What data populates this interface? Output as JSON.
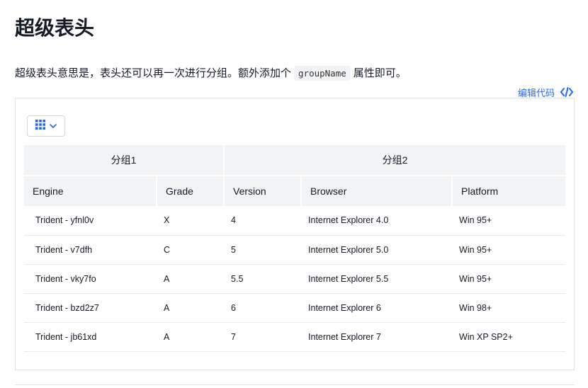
{
  "page": {
    "title": "超级表头",
    "description_before": "超级表头意思是，表头还可以再一次进行分组。额外添加个",
    "description_code": "groupName",
    "description_after": "属性即可。",
    "edit_code_label": "编辑代码"
  },
  "toolbar": {
    "columns_icon": "grid-icon",
    "dropdown_icon": "chevron-down-icon",
    "accent": "#2468f2"
  },
  "table": {
    "groups": [
      {
        "label": "分组1"
      },
      {
        "label": "分组2"
      }
    ],
    "columns": [
      "Engine",
      "Grade",
      "Version",
      "Browser",
      "Platform"
    ],
    "rows": [
      [
        "Trident - yfnl0v",
        "X",
        "4",
        "Internet Explorer 4.0",
        "Win 95+"
      ],
      [
        "Trident - v7dfh",
        "C",
        "5",
        "Internet Explorer 5.0",
        "Win 95+"
      ],
      [
        "Trident - vky7fo",
        "A",
        "5.5",
        "Internet Explorer 5.5",
        "Win 95+"
      ],
      [
        "Trident - bzd2z7",
        "A",
        "6",
        "Internet Explorer 6",
        "Win 98+"
      ],
      [
        "Trident - jb61xd",
        "A",
        "7",
        "Internet Explorer 7",
        "Win XP SP2+"
      ]
    ]
  }
}
